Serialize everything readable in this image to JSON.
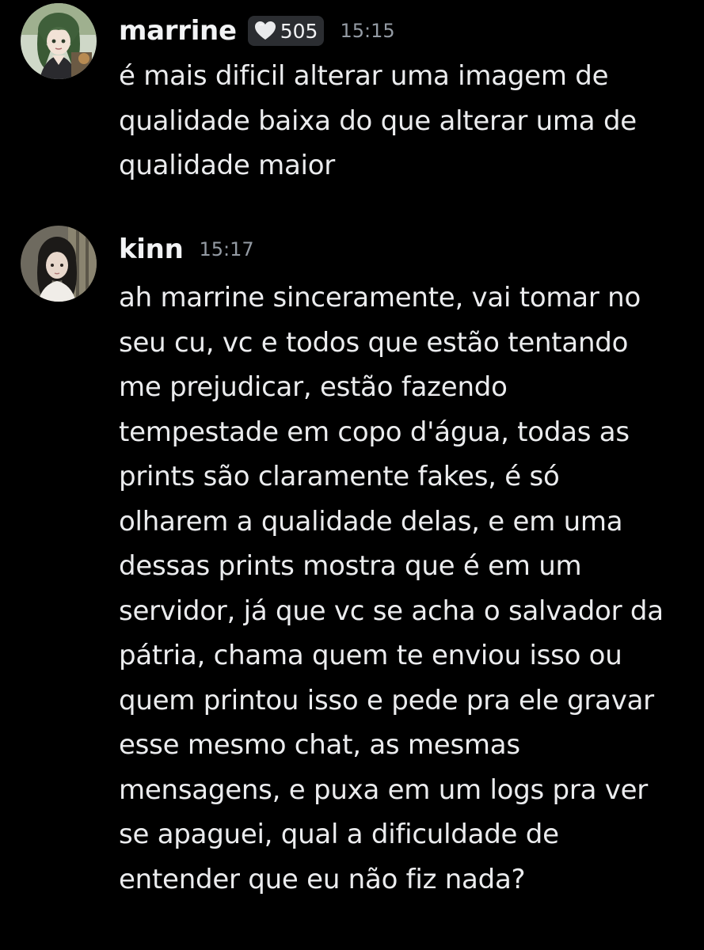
{
  "messages": [
    {
      "username": "marrine",
      "badge": {
        "icon": "heart-icon",
        "count": "505"
      },
      "timestamp": "15:15",
      "avatar": "avatar",
      "content": "é mais dificil alterar uma imagem de\nqualidade baixa do que alterar uma de\nqualidade maior"
    },
    {
      "username": "kinn",
      "timestamp": "15:17",
      "avatar": "avatar",
      "content": "ah marrine sinceramente, vai tomar no\nseu cu, vc e todos que estão tentando\nme prejudicar, estão fazendo\ntempestade em copo d'água, todas as\nprints são claramente fakes, é só\nolharem a qualidade delas, e em uma\ndessas prints mostra que é em um\nservidor, já que vc se acha o salvador da\npátria, chama quem te enviou isso ou\nquem printou isso e pede pra ele gravar\nesse mesmo chat, as mesmas\nmensagens, e puxa em um logs pra ver\nse apaguei, qual a dificuldade de\nentender que eu não fiz nada?"
    }
  ],
  "colors": {
    "background": "#000000",
    "username": "#f2f3f5",
    "text": "#ebecee",
    "timestamp": "#949ba4",
    "badge_bg": "#2b2d31"
  }
}
